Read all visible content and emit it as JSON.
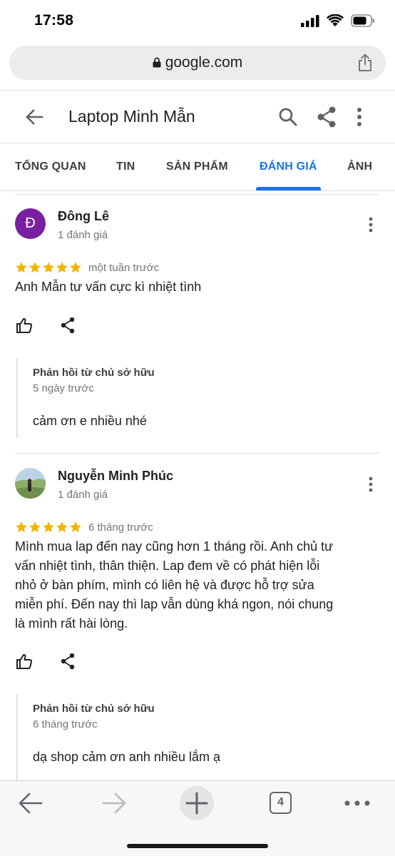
{
  "status_bar": {
    "time": "17:58"
  },
  "browser": {
    "url": "google.com",
    "open_tabs_count": "4"
  },
  "header": {
    "title": "Laptop Minh Mẫn"
  },
  "tabs": [
    {
      "label": "TỔNG QUAN",
      "active": false
    },
    {
      "label": "TIN",
      "active": false
    },
    {
      "label": "SẢN PHẨM",
      "active": false
    },
    {
      "label": "ĐÁNH GIÁ",
      "active": true
    },
    {
      "label": "ẢNH",
      "active": false
    }
  ],
  "reviews": [
    {
      "reviewer_name": "Đông Lê",
      "avatar_initial": "Đ",
      "review_count": "1 đánh giá",
      "rating": 5,
      "date": "một tuần trước",
      "text": "Anh Mẫn tư vấn cực kì nhiệt tình",
      "owner_reply": {
        "title": "Phản hồi từ chủ sở hữu",
        "date": "5 ngày trước",
        "text": "cảm ơn e nhiều nhé"
      }
    },
    {
      "reviewer_name": "Nguyễn Minh Phúc",
      "avatar_initial": "",
      "review_count": "1 đánh giá",
      "rating": 5,
      "date": "6 tháng trước",
      "text_lines": [
        "Mình mua lap đến nay cũng hơn 1 tháng rồi. Anh chủ tư",
        "vấn nhiệt tình, thân thiện. Lap đem về có phát hiện lỗi",
        "nhỏ ở bàn phím, mình có liên hệ và được hỗ trợ sửa",
        "miễn phí. Đến nay thì lap vẫn dùng khá ngon, nói chung",
        "là mình rất hài lòng."
      ],
      "owner_reply": {
        "title": "Phản hồi từ chủ sở hữu",
        "date": "6 tháng trước",
        "text": "dạ shop cảm ơn anh nhiều lắm ạ"
      }
    }
  ],
  "colors": {
    "accent": "#1a73e8",
    "star": "#f4b400",
    "avatar": "#7b1fa2",
    "text_primary": "#202124",
    "text_secondary": "#70757a"
  }
}
